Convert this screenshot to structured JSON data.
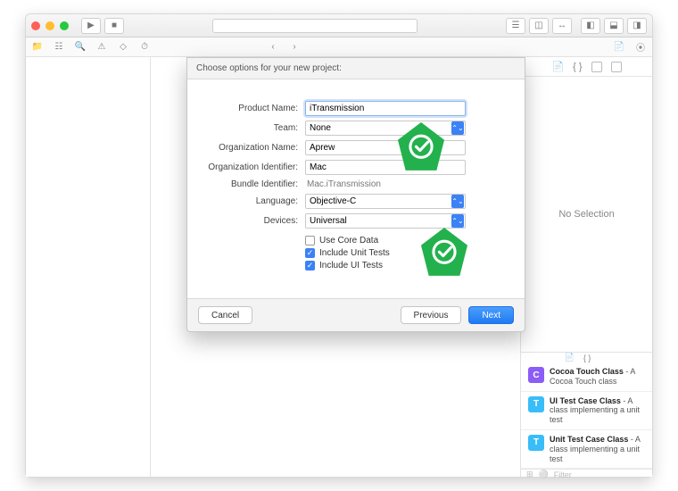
{
  "dialog": {
    "title": "Choose options for your new project:",
    "productName": {
      "label": "Product Name:",
      "value": "iTransmission"
    },
    "team": {
      "label": "Team:",
      "value": "None"
    },
    "orgName": {
      "label": "Organization Name:",
      "value": "Aprew"
    },
    "orgId": {
      "label": "Organization Identifier:",
      "value": "Mac"
    },
    "bundleId": {
      "label": "Bundle Identifier:",
      "value": "Mac.iTransmission"
    },
    "language": {
      "label": "Language:",
      "value": "Objective-C"
    },
    "devices": {
      "label": "Devices:",
      "value": "Universal"
    },
    "checks": {
      "coreData": {
        "label": "Use Core Data",
        "checked": false
      },
      "unitTests": {
        "label": "Include Unit Tests",
        "checked": true
      },
      "uiTests": {
        "label": "Include UI Tests",
        "checked": true
      }
    },
    "buttons": {
      "cancel": "Cancel",
      "previous": "Previous",
      "next": "Next"
    }
  },
  "inspector": {
    "noSelection": "No Selection"
  },
  "library": {
    "items": [
      {
        "title": "Cocoa Touch Class",
        "desc": " - A Cocoa Touch class",
        "iconColor": "#8b5cf6",
        "iconLetter": "C"
      },
      {
        "title": "UI Test Case Class",
        "desc": " - A class implementing a unit test",
        "iconColor": "#38bdf8",
        "iconLetter": "T"
      },
      {
        "title": "Unit Test Case Class",
        "desc": " - A class implementing a unit test",
        "iconColor": "#38bdf8",
        "iconLetter": "T"
      }
    ],
    "filterPlaceholder": "Filter"
  }
}
